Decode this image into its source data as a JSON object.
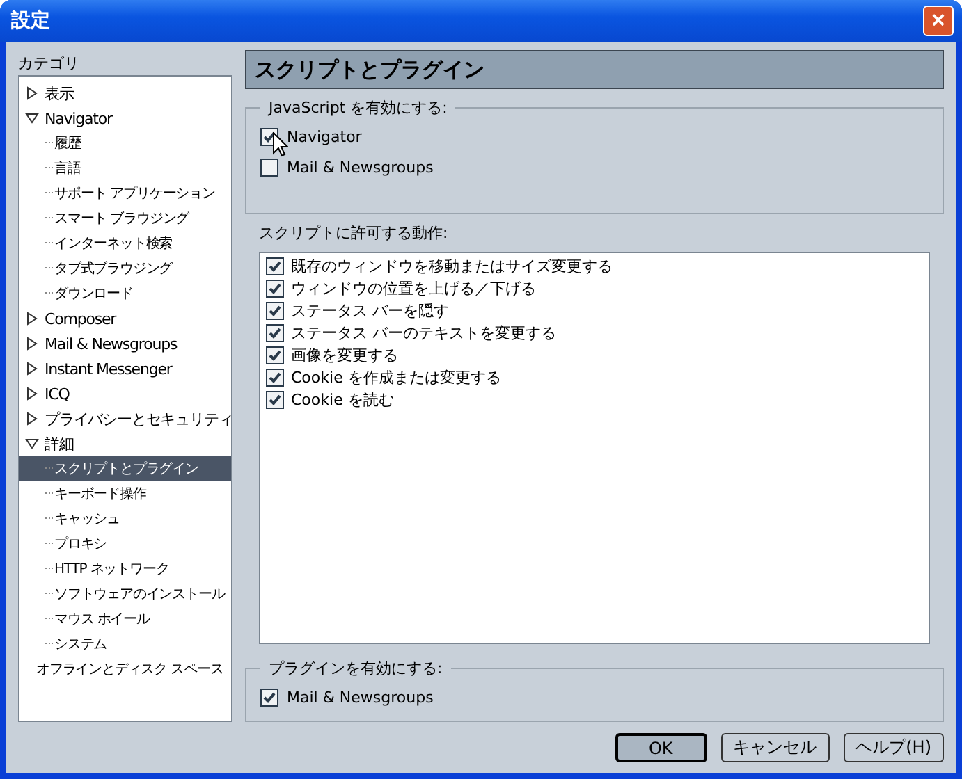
{
  "window": {
    "title": "設定",
    "close": "×"
  },
  "sidebar": {
    "label": "カテゴリ",
    "items": [
      {
        "label": "表示",
        "kind": "group",
        "expanded": false,
        "selected": false
      },
      {
        "label": "Navigator",
        "kind": "group",
        "expanded": true,
        "selected": false,
        "children": [
          {
            "label": "履歴",
            "selected": false
          },
          {
            "label": "言語",
            "selected": false
          },
          {
            "label": "サポート アプリケーション",
            "selected": false
          },
          {
            "label": "スマート ブラウジング",
            "selected": false
          },
          {
            "label": "インターネット検索",
            "selected": false
          },
          {
            "label": "タブ式ブラウジング",
            "selected": false
          },
          {
            "label": "ダウンロード",
            "selected": false
          }
        ]
      },
      {
        "label": "Composer",
        "kind": "group",
        "expanded": false,
        "selected": false
      },
      {
        "label": "Mail & Newsgroups",
        "kind": "group",
        "expanded": false,
        "selected": false
      },
      {
        "label": "Instant Messenger",
        "kind": "group",
        "expanded": false,
        "selected": false
      },
      {
        "label": "ICQ",
        "kind": "group",
        "expanded": false,
        "selected": false
      },
      {
        "label": "プライバシーとセキュリティ",
        "kind": "group",
        "expanded": false,
        "selected": false
      },
      {
        "label": "詳細",
        "kind": "group",
        "expanded": true,
        "selected": false,
        "children": [
          {
            "label": "スクリプトとプラグイン",
            "selected": true
          },
          {
            "label": "キーボード操作",
            "selected": false
          },
          {
            "label": "キャッシュ",
            "selected": false
          },
          {
            "label": "プロキシ",
            "selected": false
          },
          {
            "label": "HTTP ネットワーク",
            "selected": false
          },
          {
            "label": "ソフトウェアのインストール",
            "selected": false
          },
          {
            "label": "マウス ホイール",
            "selected": false
          },
          {
            "label": "システム",
            "selected": false
          }
        ]
      },
      {
        "label": "オフラインとディスク スペース",
        "kind": "leaf",
        "selected": false
      }
    ]
  },
  "panel": {
    "title": "スクリプトとプラグイン",
    "javascript": {
      "legend": "JavaScript を有効にする:",
      "options": [
        {
          "label": "Navigator",
          "checked": true
        },
        {
          "label": "Mail & Newsgroups",
          "checked": false
        }
      ]
    },
    "scripts": {
      "label": "スクリプトに許可する動作:",
      "options": [
        {
          "label": "既存のウィンドウを移動またはサイズ変更する",
          "checked": true
        },
        {
          "label": "ウィンドウの位置を上げる／下げる",
          "checked": true
        },
        {
          "label": "ステータス バーを隠す",
          "checked": true
        },
        {
          "label": "ステータス バーのテキストを変更する",
          "checked": true
        },
        {
          "label": "画像を変更する",
          "checked": true
        },
        {
          "label": "Cookie を作成または変更する",
          "checked": true
        },
        {
          "label": "Cookie を読む",
          "checked": true
        }
      ]
    },
    "plugins": {
      "legend": "プラグインを有効にする:",
      "options": [
        {
          "label": "Mail & Newsgroups",
          "checked": true
        }
      ]
    }
  },
  "buttons": [
    {
      "label": "OK",
      "default": true
    },
    {
      "label": "キャンセル",
      "default": false
    },
    {
      "label": "ヘルプ(H)",
      "default": false
    }
  ]
}
